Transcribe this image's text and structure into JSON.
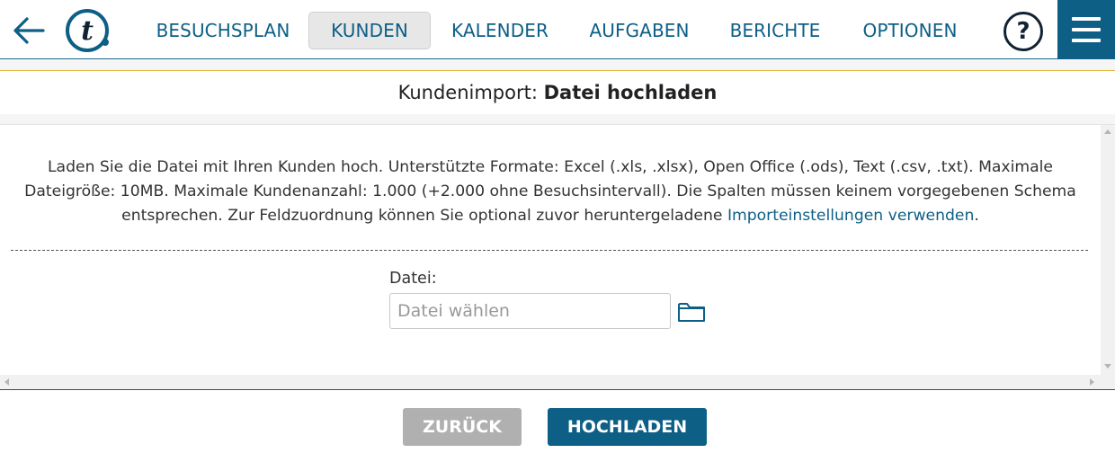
{
  "nav": {
    "back_icon": "arrow-left-icon",
    "logo_icon": "t-logo-icon",
    "items": [
      {
        "label": "BESUCHSPLAN",
        "active": false
      },
      {
        "label": "KUNDEN",
        "active": true
      },
      {
        "label": "KALENDER",
        "active": false
      },
      {
        "label": "AUFGABEN",
        "active": false
      },
      {
        "label": "BERICHTE",
        "active": false
      },
      {
        "label": "OPTIONEN",
        "active": false
      }
    ],
    "help_label": "?",
    "menu_icon": "hamburger-menu-icon"
  },
  "page": {
    "title_prefix": "Kundenimport: ",
    "title_bold": "Datei hochladen"
  },
  "content": {
    "description_text": "Laden Sie die Datei mit Ihren Kunden hoch. Unterstützte Formate: Excel (.xls, .xlsx), Open Office (.ods), Text (.csv, .txt). Maximale Dateigröße: 10MB. Maximale Kundenanzahl: 1.000 (+2.000 ohne Besuchsintervall). Die Spalten müssen keinem vorgegebenen Schema entsprechen. Zur Feldzuordnung können Sie optional zuvor heruntergeladene ",
    "description_link": "Importeinstellungen verwenden",
    "description_end": ".",
    "file_label": "Datei:",
    "file_placeholder": "Datei wählen",
    "file_value": "",
    "folder_icon": "folder-icon"
  },
  "footer": {
    "back_label": "ZURÜCK",
    "upload_label": "HOCHLADEN"
  },
  "colors": {
    "brand": "#0d5f86",
    "accent_line": "#e3b33f",
    "disabled_button": "#b0b0b0"
  }
}
